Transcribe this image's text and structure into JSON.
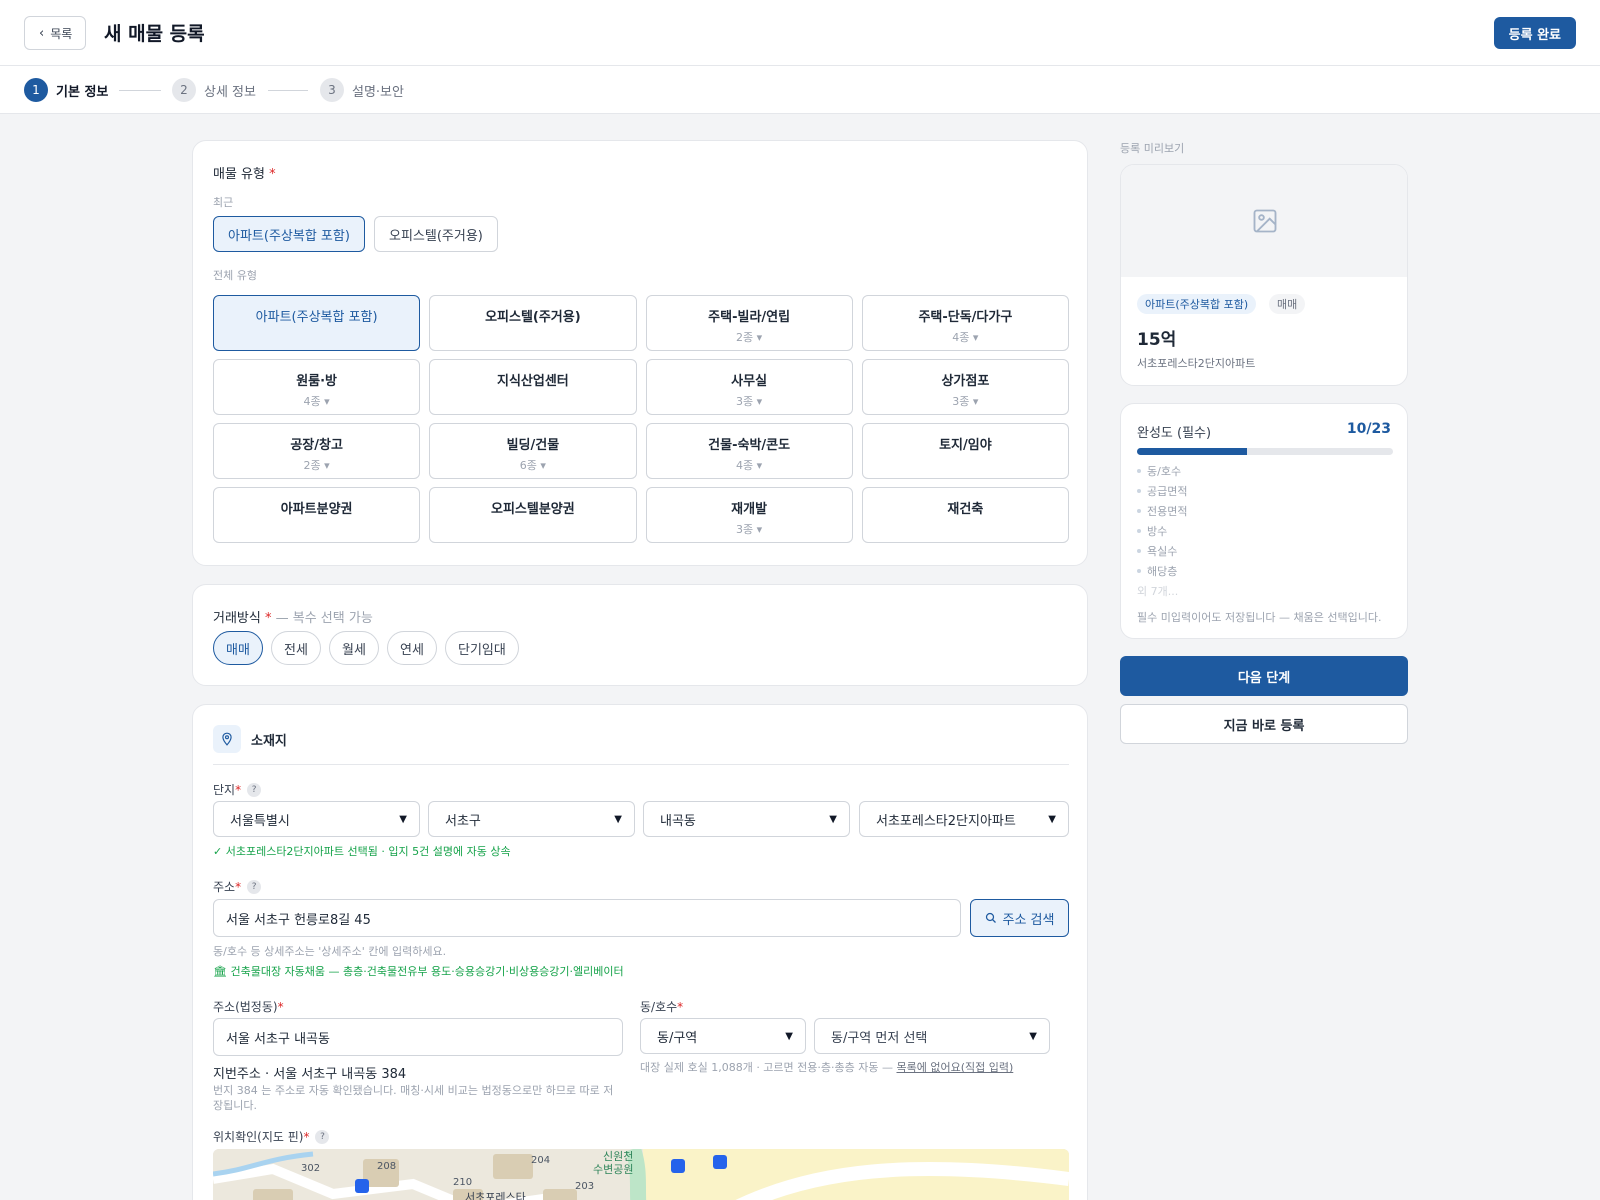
{
  "header": {
    "back_label": "목록",
    "title": "새 매물 등록",
    "submit_label": "등록 완료"
  },
  "steps": [
    {
      "num": "1",
      "label": "기본 정보"
    },
    {
      "num": "2",
      "label": "상세 정보"
    },
    {
      "num": "3",
      "label": "설명·보안"
    }
  ],
  "property_type": {
    "title": "매물 유형",
    "required_mark": "*",
    "recent_label": "최근",
    "recent": [
      "아파트(주상복합 포함)",
      "오피스텔(주거용)"
    ],
    "all_label": "전체 유형",
    "types": [
      {
        "name": "아파트(주상복합 포함)",
        "sub": ""
      },
      {
        "name": "오피스텔(주거용)",
        "sub": ""
      },
      {
        "name": "주택-빌라/연립",
        "sub": "2종 ▾"
      },
      {
        "name": "주택-단독/다가구",
        "sub": "4종 ▾"
      },
      {
        "name": "원룸·방",
        "sub": "4종 ▾"
      },
      {
        "name": "지식산업센터",
        "sub": ""
      },
      {
        "name": "사무실",
        "sub": "3종 ▾"
      },
      {
        "name": "상가점포",
        "sub": "3종 ▾"
      },
      {
        "name": "공장/창고",
        "sub": "2종 ▾"
      },
      {
        "name": "빌딩/건물",
        "sub": "6종 ▾"
      },
      {
        "name": "건물-숙박/콘도",
        "sub": "4종 ▾"
      },
      {
        "name": "토지/임야",
        "sub": ""
      },
      {
        "name": "아파트분양권",
        "sub": ""
      },
      {
        "name": "오피스텔분양권",
        "sub": ""
      },
      {
        "name": "재개발",
        "sub": "3종 ▾"
      },
      {
        "name": "재건축",
        "sub": ""
      }
    ]
  },
  "deal": {
    "title": "거래방식",
    "required_mark": "*",
    "hint": "— 복수 선택 가능",
    "options": [
      "매매",
      "전세",
      "월세",
      "연세",
      "단기임대"
    ]
  },
  "location": {
    "title": "소재지",
    "complex_label": "단지",
    "required_mark": "*",
    "help": "?",
    "selects": [
      "서울특별시",
      "서초구",
      "내곡동",
      "서초포레스타2단지아파트"
    ],
    "complex_note": "✓ 서초포레스타2단지아파트 선택됨 · 입지 5건 설명에 자동 상속",
    "address_label": "주소",
    "address_value": "서울 서초구 헌릉로8길 45",
    "search_label": "주소 검색",
    "address_note": "동/호수 등 상세주소는 '상세주소' 칸에 입력하세요.",
    "registry_note": "건축물대장 자동채움 — 총층·건축물전유부 용도·승용승강기·비상용승강기·엘리베이터",
    "legal_label": "주소(법정동)",
    "legal_value": "서울 서초구 내곡동",
    "lot_text": "지번주소 · 서울 서초구 내곡동 384",
    "lot_note": "번지 384 는 주소로 자동 확인됐습니다. 매칭·시세 비교는 법정동으로만 하므로 따로 저장됩니다.",
    "unit_label": "동/호수",
    "unit_select1": "동/구역",
    "unit_select2": "동/구역 먼저 선택",
    "unit_note": "대장 실제 호실 1,088개 · 고르면 전용·층·총층 자동 —",
    "unit_link": "목록에 없어요(직접 입력)",
    "map_label": "위치확인(지도 핀)",
    "map_labels": [
      "302",
      "208",
      "204",
      "210",
      "203",
      "신원천",
      "수변공원",
      "서초포레스타"
    ]
  },
  "preview": {
    "label": "등록 미리보기",
    "type_badge": "아파트(주상복합 포함)",
    "deal_badge": "매매",
    "price": "15억",
    "name": "서초포레스타2단지아파트"
  },
  "completeness": {
    "title": "완성도 (필수)",
    "count": "10/23",
    "progress": 0.43,
    "items": [
      "동/호수",
      "공급면적",
      "전용면적",
      "방수",
      "욕실수",
      "해당층"
    ],
    "more": "외 7개...",
    "note": "필수 미입력이어도 저장됩니다 — 채움은 선택입니다."
  },
  "actions": {
    "next": "다음 단계",
    "register_now": "지금 바로 등록"
  },
  "colors": {
    "accent": "#1e5aa0",
    "accent_bg": "#eaf2fb",
    "success": "#16a34a",
    "required": "#dc2626"
  }
}
